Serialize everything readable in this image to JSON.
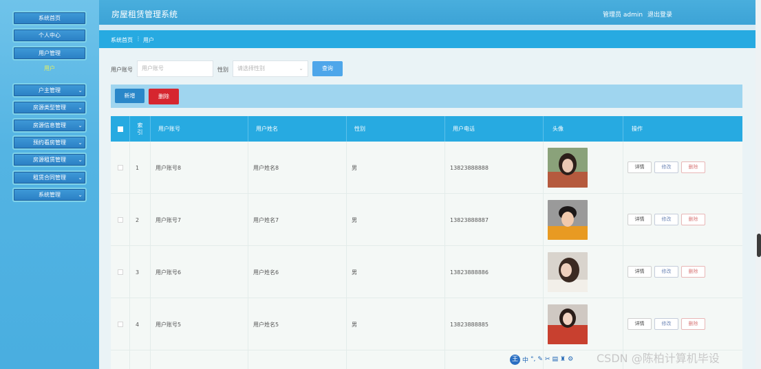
{
  "app": {
    "title": "房屋租赁管理系统",
    "user": "管理员 admin",
    "logout": "退出登录"
  },
  "sidebar": {
    "items": [
      {
        "label": "系统首页"
      },
      {
        "label": "个人中心"
      },
      {
        "label": "用户管理"
      },
      {
        "label": "户主管理"
      },
      {
        "label": "房源类型管理"
      },
      {
        "label": "房源信息管理"
      },
      {
        "label": "预约看房管理"
      },
      {
        "label": "房源租赁管理"
      },
      {
        "label": "租赁合同管理"
      },
      {
        "label": "系统管理"
      }
    ],
    "sub_item": "用户"
  },
  "breadcrumb": {
    "home": "系统首页",
    "current": "用户"
  },
  "search": {
    "account_label": "用户账号",
    "account_placeholder": "用户账号",
    "gender_label": "性别",
    "gender_placeholder": "请选择性别",
    "button": "查询"
  },
  "actions": {
    "add": "新增",
    "delete": "删除"
  },
  "table": {
    "headers": [
      "索引",
      "用户账号",
      "用户姓名",
      "性别",
      "用户电话",
      "头像",
      "操作"
    ],
    "rows": [
      {
        "index": "1",
        "account": "用户账号8",
        "name": "用户姓名8",
        "gender": "男",
        "phone": "13823888888"
      },
      {
        "index": "2",
        "account": "用户账号7",
        "name": "用户姓名7",
        "gender": "男",
        "phone": "13823888887"
      },
      {
        "index": "3",
        "account": "用户账号6",
        "name": "用户姓名6",
        "gender": "男",
        "phone": "13823888886"
      },
      {
        "index": "4",
        "account": "用户账号5",
        "name": "用户姓名5",
        "gender": "男",
        "phone": "13823888885"
      }
    ],
    "row_actions": {
      "detail": "详情",
      "edit": "修改",
      "delete": "删除"
    }
  },
  "watermark": "CSDN @陈柏计算机毕设",
  "ime_toolbar": {
    "logo": "王",
    "mode": "中"
  }
}
